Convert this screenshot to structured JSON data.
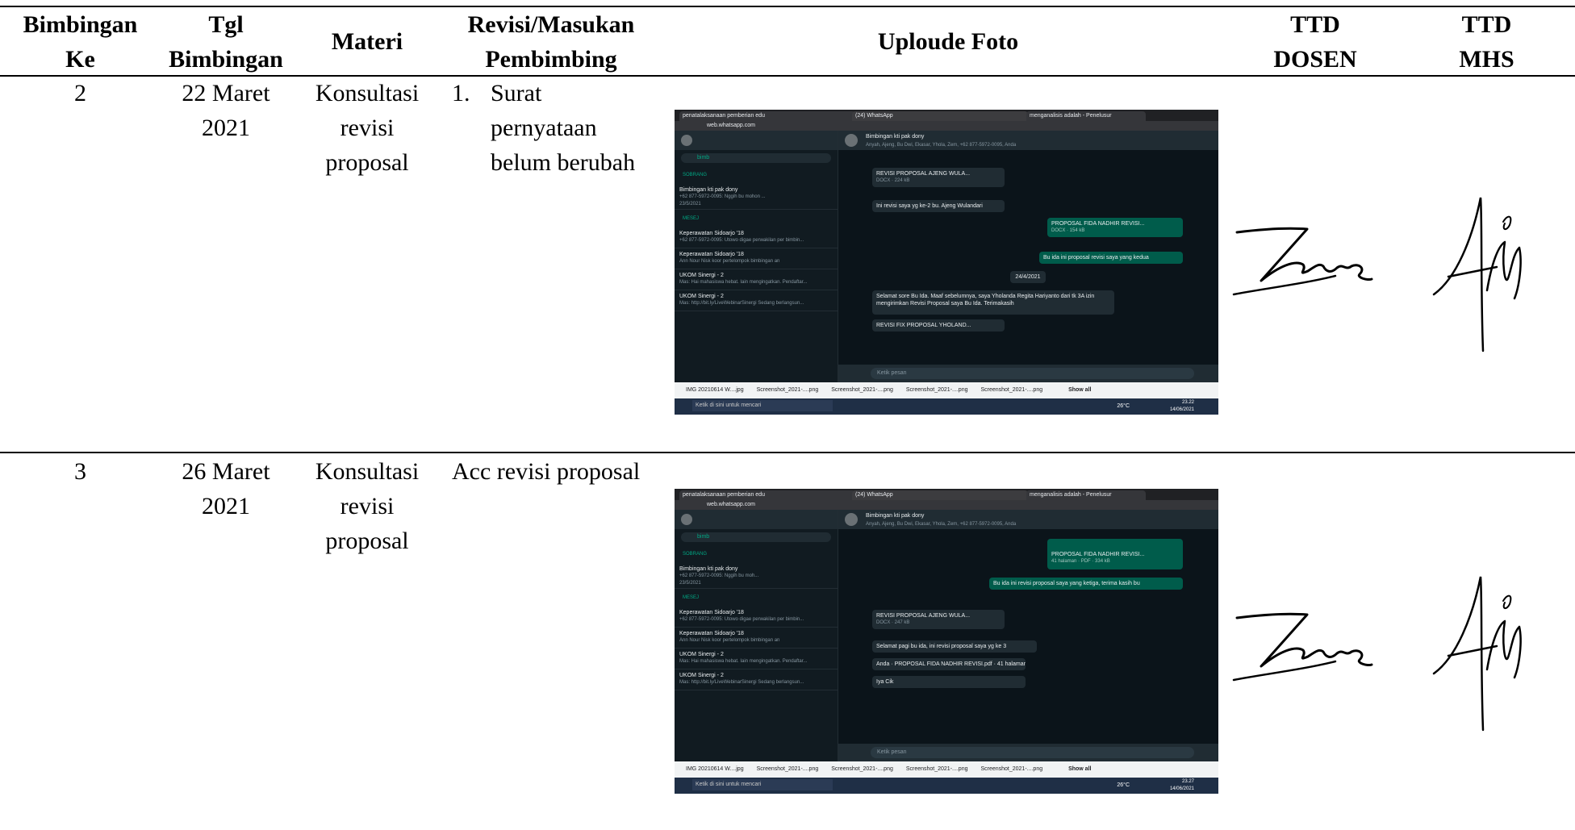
{
  "table": {
    "headers": {
      "bimbingan_ke": [
        "Bimbingan",
        "Ke"
      ],
      "tgl": [
        "Tgl",
        "Bimbingan"
      ],
      "materi": "Materi",
      "revisi": [
        "Revisi/Masukan",
        "Pembimbing"
      ],
      "foto": "Uploude Foto",
      "ttd_dosen": [
        "TTD",
        "DOSEN"
      ],
      "ttd_mhs": [
        "TTD",
        "MHS"
      ]
    },
    "rows": [
      {
        "no": "2",
        "tgl": [
          "22 Maret",
          "2021"
        ],
        "materi": [
          "Konsultasi",
          "revisi",
          "proposal"
        ],
        "revisi_num": "1.",
        "revisi": [
          "Surat",
          "pernyataan",
          "belum berubah"
        ]
      },
      {
        "no": "3",
        "tgl": [
          "26 Maret",
          "2021"
        ],
        "materi": [
          "Konsultasi",
          "revisi",
          "proposal"
        ],
        "revisi": [
          "Acc revisi proposal"
        ]
      }
    ]
  },
  "screenshots": [
    {
      "tabs": [
        "penatalaksanaan pemberian edu",
        "(24) WhatsApp",
        "menganalisis adalah - Penelusur"
      ],
      "address": "web.whatsapp.com",
      "search": "bimb",
      "section_chats": "SOBRANG",
      "section_messages": "MESEJ",
      "chats": [
        {
          "title": "Bimbingan kti pak dony",
          "sub": "+62 877-5972-0095: Nggih bu mohon ...",
          "time": "23/5/2021"
        },
        {
          "title": "Keperawatan Sidoarjo '18",
          "sub": "+62 877-5972-0095: Utowo digae perwakilan per bimbin...",
          "time": "15.55"
        },
        {
          "title": "Keperawatan Sidoarjo '18",
          "sub": "Ann Nour Nisk koor pertelompok bimbingan an",
          "time": "12.05"
        },
        {
          "title": "UKOM Sinergi - 2",
          "sub": "Mas: Hai mahasiswa hebat. Iain mengingatkan. Pendaftar...",
          "time": "semalam"
        },
        {
          "title": "UKOM Sinergi - 2",
          "sub": "Mas: http://bit.ly/LiveWebinarSinergi Sedang berlangsun...",
          "time": "Sabtu"
        }
      ],
      "chat_title": "Bimbingan kti pak dony",
      "chat_members": "Anyah, Ajeng, Bu Dwi, Ekasar, Yhola, Zem, +62 877-5972-0095, Anda",
      "messages": [
        {
          "type": "in",
          "text": "REVISI PROPOSAL AJENG WULA...",
          "meta": "DOCX · 224 kB"
        },
        {
          "type": "in",
          "text": "Ini revisi saya yg ke-2 bu. Ajeng Wulandari"
        },
        {
          "type": "out",
          "text": "PROPOSAL FIDA NADHIR REVISI...",
          "meta": "DOCX · 154 kB"
        },
        {
          "type": "out",
          "text": "Bu ida ini proposal revisi saya yang kedua"
        },
        {
          "type": "date",
          "text": "24/4/2021"
        },
        {
          "type": "in",
          "text": "Selamat sore Bu Ida. Maaf sebelumnya, saya Yholanda Regita Hariyanto dari tk 3A izin mengirimkan Revisi Proposal saya Bu Ida. Terimakasih"
        },
        {
          "type": "in",
          "text": "REVISI FIX PROPOSAL YHOLAND..."
        }
      ],
      "compose": "Ketik pesan",
      "downloads": [
        "IMG 20210614 W....jpg",
        "Screenshot_2021-....png",
        "Screenshot_2021-....png",
        "Screenshot_2021-....png",
        "Screenshot_2021-....png"
      ],
      "show_all": "Show all",
      "taskbar_search": "Ketik di sini untuk mencari",
      "temp": "26°C",
      "time": "23.22",
      "date": "14/06/2021"
    },
    {
      "tabs": [
        "penatalaksanaan pemberian edu",
        "(24) WhatsApp",
        "menganalisis adalah - Penelusur"
      ],
      "address": "web.whatsapp.com",
      "search": "bimb",
      "section_chats": "SOBRANG",
      "section_messages": "MESEJ",
      "chats": [
        {
          "title": "Bimbingan kti pak dony",
          "sub": "+62 877-5972-0095: Nggih bu moh...",
          "time": "23/5/2021"
        },
        {
          "title": "Keperawatan Sidoarjo '18",
          "sub": "+62 877-5972-0095: Utowo digae perwakilan per bimbin...",
          "time": "15.55"
        },
        {
          "title": "Keperawatan Sidoarjo '18",
          "sub": "Ann Nour Nisk koor pertelompok bimbingan an",
          "time": "12.05"
        },
        {
          "title": "UKOM Sinergi - 2",
          "sub": "Mas: Hai mahasiswa hebat. Iain mengingatkan. Pendaftar...",
          "time": "semalam"
        },
        {
          "title": "UKOM Sinergi - 2",
          "sub": "Mas: http://bit.ly/LiveWebinarSinergi Sedang berlangsun...",
          "time": "Sabtu"
        }
      ],
      "chat_title": "Bimbingan kti pak dony",
      "chat_members": "Anyah, Ajeng, Bu Dwi, Ekasar, Yhola, Zem, +62 877-5972-0095, Anda",
      "messages": [
        {
          "type": "out",
          "text": "PROPOSAL FIDA NADHIR REVISI...",
          "meta": "41 halaman · PDF · 334 kB"
        },
        {
          "type": "out",
          "text": "Bu ida ini revisi proposal saya yang ketiga, terima kasih bu"
        },
        {
          "type": "in",
          "text": "REVISI PROPOSAL AJENG WULA...",
          "meta": "DOCX · 247 kB"
        },
        {
          "type": "in",
          "text": "Selamat pagi bu ida, ini revisi proposal saya yg ke 3"
        },
        {
          "type": "in",
          "text": "Anda · PROPOSAL FIDA NADHIR REVISI.pdf · 41 halaman"
        },
        {
          "type": "in",
          "text": "Iya Cik"
        }
      ],
      "compose": "Ketik pesan",
      "downloads": [
        "IMG 20210614 W....jpg",
        "Screenshot_2021-....png",
        "Screenshot_2021-....png",
        "Screenshot_2021-....png",
        "Screenshot_2021-....png"
      ],
      "show_all": "Show all",
      "taskbar_search": "Ketik di sini untuk mencari",
      "temp": "26°C",
      "time": "23.27",
      "date": "14/06/2021"
    }
  ]
}
